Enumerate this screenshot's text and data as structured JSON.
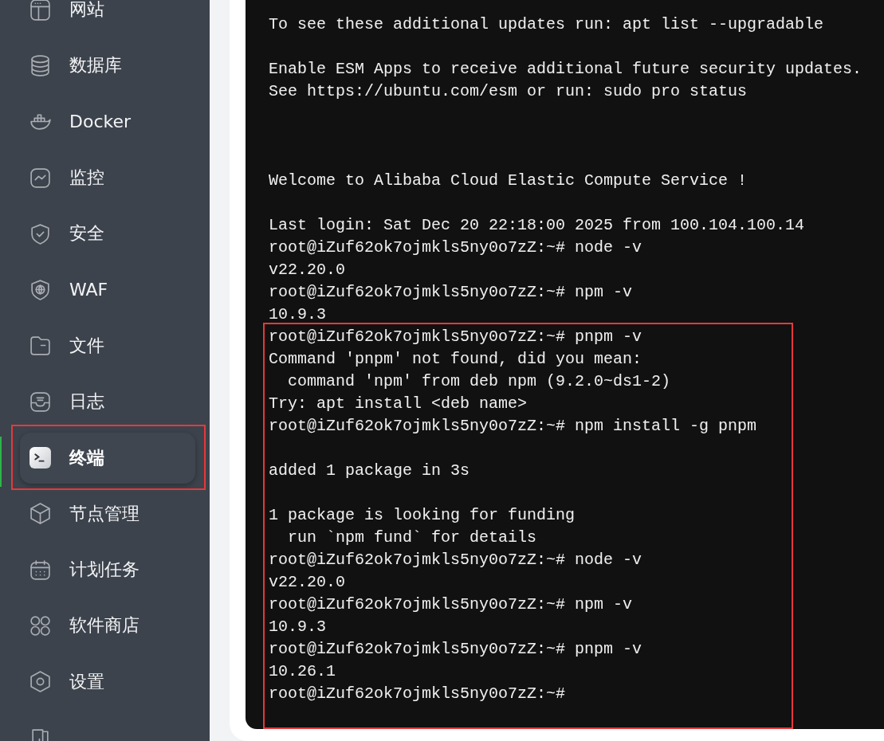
{
  "sidebar": {
    "items": [
      {
        "label": "网站",
        "selected": false,
        "annotated": false
      },
      {
        "label": "数据库",
        "selected": false,
        "annotated": false
      },
      {
        "label": "Docker",
        "selected": false,
        "annotated": false
      },
      {
        "label": "监控",
        "selected": false,
        "annotated": false
      },
      {
        "label": "安全",
        "selected": false,
        "annotated": false
      },
      {
        "label": "WAF",
        "selected": false,
        "annotated": false
      },
      {
        "label": "文件",
        "selected": false,
        "annotated": false
      },
      {
        "label": "日志",
        "selected": false,
        "annotated": false
      },
      {
        "label": "终端",
        "selected": true,
        "annotated": true
      },
      {
        "label": "节点管理",
        "selected": false,
        "annotated": false
      },
      {
        "label": "计划任务",
        "selected": false,
        "annotated": false
      },
      {
        "label": "软件商店",
        "selected": false,
        "annotated": false
      },
      {
        "label": "设置",
        "selected": false,
        "annotated": false
      }
    ]
  },
  "terminal": {
    "lines": [
      {
        "kind": "blank"
      },
      {
        "kind": "text",
        "text": "To see these additional updates run: apt list --upgradable"
      },
      {
        "kind": "blank"
      },
      {
        "kind": "text",
        "text": "Enable ESM Apps to receive additional future security updates."
      },
      {
        "kind": "text",
        "text": "See https://ubuntu.com/esm or run: sudo pro status"
      },
      {
        "kind": "blank"
      },
      {
        "kind": "blank"
      },
      {
        "kind": "blank"
      },
      {
        "kind": "text",
        "text": "Welcome to Alibaba Cloud Elastic Compute Service !"
      },
      {
        "kind": "blank"
      },
      {
        "kind": "text",
        "text": "Last login: Sat Dec 20 22:18:00 2025 from 100.104.100.14"
      },
      {
        "kind": "text",
        "text": "root@iZuf62ok7ojmkls5ny0o7zZ:~# node -v"
      },
      {
        "kind": "text",
        "text": "v22.20.0"
      },
      {
        "kind": "text",
        "text": "root@iZuf62ok7ojmkls5ny0o7zZ:~# npm -v"
      },
      {
        "kind": "text",
        "text": "10.9.3"
      }
    ],
    "highlighted_lines": [
      {
        "kind": "text",
        "text": "root@iZuf62ok7ojmkls5ny0o7zZ:~# pnpm -v"
      },
      {
        "kind": "text",
        "text": "Command 'pnpm' not found, did you mean:"
      },
      {
        "kind": "text",
        "text": "  command 'npm' from deb npm (9.2.0~ds1-2)"
      },
      {
        "kind": "text",
        "text": "Try: apt install <deb name>"
      },
      {
        "kind": "text",
        "text": "root@iZuf62ok7ojmkls5ny0o7zZ:~# npm install -g pnpm"
      },
      {
        "kind": "blank"
      },
      {
        "kind": "text",
        "text": "added 1 package in 3s"
      },
      {
        "kind": "blank"
      },
      {
        "kind": "text",
        "text": "1 package is looking for funding"
      },
      {
        "kind": "text",
        "text": "  run `npm fund` for details"
      },
      {
        "kind": "text",
        "text": "root@iZuf62ok7ojmkls5ny0o7zZ:~# node -v"
      },
      {
        "kind": "text",
        "text": "v22.20.0"
      },
      {
        "kind": "text",
        "text": "root@iZuf62ok7ojmkls5ny0o7zZ:~# npm -v"
      },
      {
        "kind": "text",
        "text": "10.9.3"
      },
      {
        "kind": "text",
        "text": "root@iZuf62ok7ojmkls5ny0o7zZ:~# pnpm -v"
      },
      {
        "kind": "text",
        "text": "10.26.1"
      },
      {
        "kind": "text",
        "text": "root@iZuf62ok7ojmkls5ny0o7zZ:~#"
      }
    ]
  }
}
